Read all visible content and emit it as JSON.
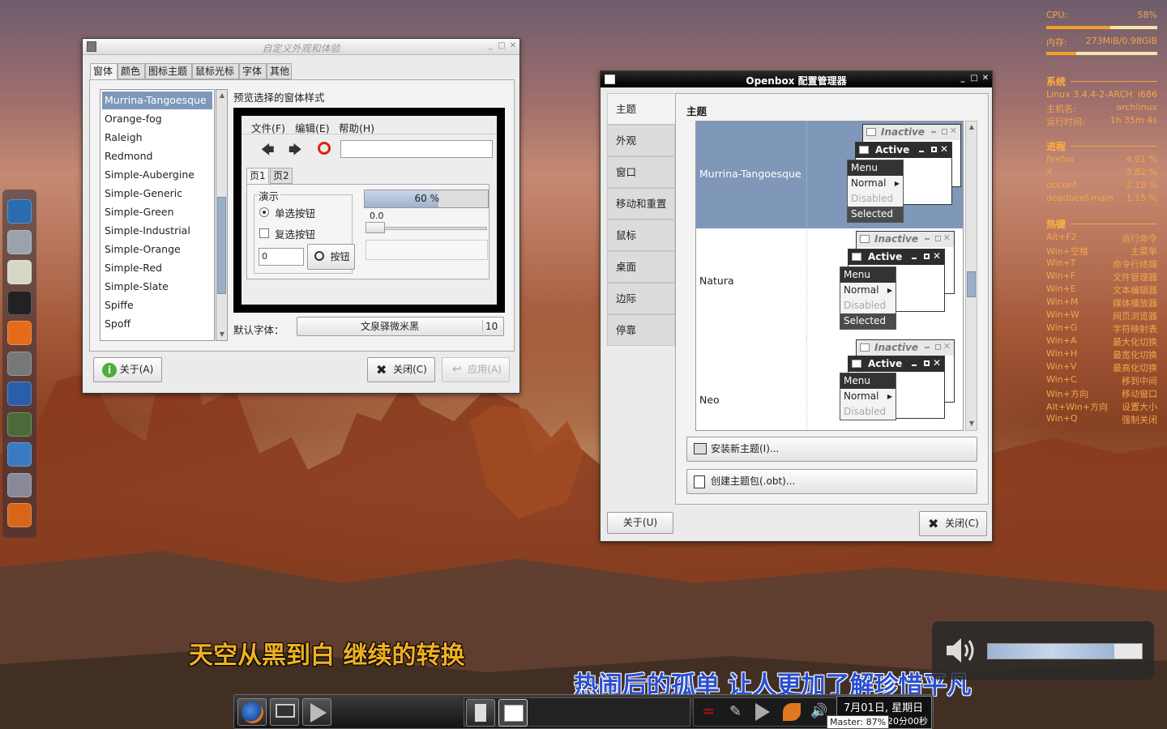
{
  "conky": {
    "cpu_label": "CPU:",
    "cpu_value": "58%",
    "cpu_percent": 58,
    "mem_label": "内存:",
    "mem_value": "273MiB/0.98GiB",
    "mem_percent": 27,
    "system_heading": "系统",
    "system": [
      {
        "label": "Linux 3.4.4-2-ARCH",
        "value": "i686"
      },
      {
        "label": "主机名:",
        "value": "archlinux"
      },
      {
        "label": "运行时间:",
        "value": "1h 35m 4s"
      }
    ],
    "process_heading": "进程",
    "processes": [
      {
        "name": "firefox",
        "value": "4.91 %"
      },
      {
        "name": "X",
        "value": "3.82 %"
      },
      {
        "name": "obconf",
        "value": "2.19 %"
      },
      {
        "name": "deadbeef-main",
        "value": "1.15 %"
      }
    ],
    "hotkey_heading": "热键",
    "hotkeys": [
      {
        "key": "Alt+F2",
        "action": "运行命令"
      },
      {
        "key": "Win+空格",
        "action": "主菜单"
      },
      {
        "key": "Win+T",
        "action": "命令行终端"
      },
      {
        "key": "Win+F",
        "action": "文件管理器"
      },
      {
        "key": "Win+E",
        "action": "文本编辑器"
      },
      {
        "key": "Win+M",
        "action": "媒体播放器"
      },
      {
        "key": "Win+W",
        "action": "网页浏览器"
      },
      {
        "key": "Win+G",
        "action": "字符映射表"
      },
      {
        "key": "Win+A",
        "action": "最大化切换"
      },
      {
        "key": "Win+H",
        "action": "最宽化切换"
      },
      {
        "key": "Win+V",
        "action": "最高化切换"
      },
      {
        "key": "Win+C",
        "action": "移到中间"
      },
      {
        "key": "Win+方向",
        "action": "移动窗口"
      },
      {
        "key": "Alt+Win+方向",
        "action": "设置大小"
      },
      {
        "key": "Win+Q",
        "action": "强制关闭"
      }
    ]
  },
  "dock": {
    "icons": [
      "anchor-icon",
      "file-cabinet-icon",
      "text-editor-icon",
      "terminal-icon",
      "firefox-icon",
      "media-play-icon",
      "video-player-icon",
      "globe-icon",
      "pen-icon",
      "calculator-icon",
      "feather-icon"
    ]
  },
  "appearance_window": {
    "title": "自定义外观和体验",
    "tabs": [
      "窗体",
      "颜色",
      "图标主题",
      "鼠标光标",
      "字体",
      "其他"
    ],
    "themes": [
      "Murrina-Tangoesque",
      "Orange-fog",
      "Raleigh",
      "Redmond",
      "Simple-Aubergine",
      "Simple-Generic",
      "Simple-Green",
      "Simple-Industrial",
      "Simple-Orange",
      "Simple-Red",
      "Simple-Slate",
      "Spiffe",
      "Spoff"
    ],
    "preview_label": "预览选择的窗体样式",
    "preview": {
      "menu": [
        "文件(F)",
        "编辑(E)",
        "帮助(H)"
      ],
      "tabs": [
        "页1",
        "页2"
      ],
      "frame_label": "演示",
      "radio_label": "单选按钮",
      "check_label": "复选按钮",
      "spin_value": "0",
      "button_label": "按钮",
      "progress_text": "60 %",
      "progress_percent": 60,
      "scale_value": "0.0"
    },
    "font_label": "默认字体：",
    "font_name": "文泉驿微米黑",
    "font_size": "10",
    "about_button": "关于(A)",
    "close_button": "关闭(C)",
    "apply_button": "应用(A)"
  },
  "openbox_window": {
    "title": "Openbox 配置管理器",
    "sidebar": [
      "主题",
      "外观",
      "窗口",
      "移动和重置",
      "鼠标",
      "桌面",
      "边际",
      "停靠"
    ],
    "section_title": "主题",
    "themes": [
      {
        "name": "Murrina-Tangoesque"
      },
      {
        "name": "Natura"
      },
      {
        "name": "Neo"
      }
    ],
    "preview": {
      "inactive": "Inactive",
      "active": "Active",
      "menu": "Menu",
      "normal": "Normal",
      "disabled": "Disabled",
      "selected": "Selected"
    },
    "install_button": "安装新主题(I)...",
    "create_button": "创建主题包(.obt)...",
    "about_button": "关于(U)",
    "close_button": "关闭(C)"
  },
  "subtitles": {
    "line1": "天空从黑到白 继续的转换",
    "line2": "热闹后的孤单 让人更加了解珍惜平凡"
  },
  "volume_osd": {
    "level_percent": 82
  },
  "taskbar": {
    "volume_status": "Master: 87%",
    "date": "7月01日, 星期日",
    "time": "20分00秒"
  }
}
